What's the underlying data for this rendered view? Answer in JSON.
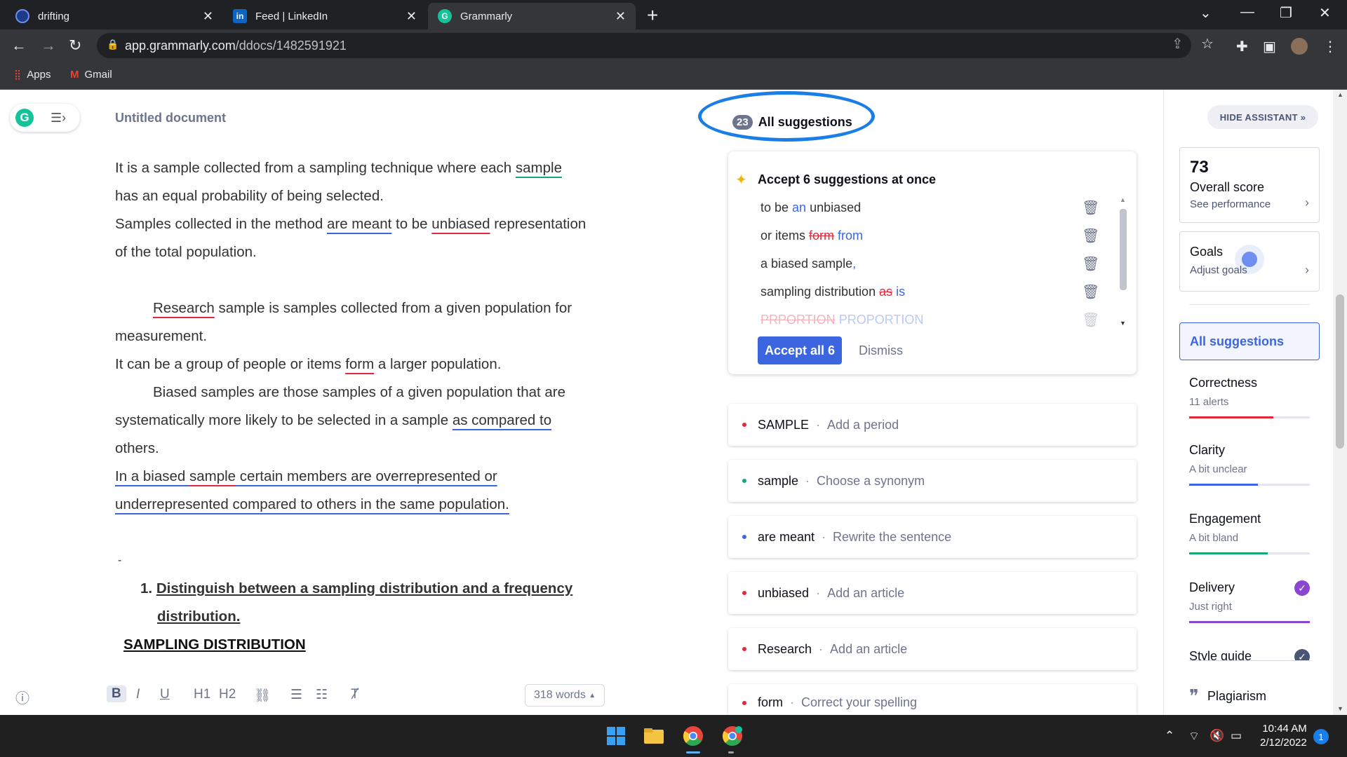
{
  "browser": {
    "tabs": [
      {
        "title": "drifting",
        "icon": "drifting-favicon"
      },
      {
        "title": "Feed | LinkedIn",
        "icon": "linkedin-favicon"
      },
      {
        "title": "Grammarly",
        "icon": "grammarly-favicon",
        "active": true
      }
    ],
    "url_host": "app.grammarly.com",
    "url_path": "/ddocs/1482591921",
    "bookmarks": [
      {
        "label": "Apps",
        "icon": "apps-grid-icon"
      },
      {
        "label": "Gmail",
        "icon": "gmail-icon"
      }
    ]
  },
  "editor": {
    "title": "Untitled document",
    "paragraphs": {
      "p1a": " It is a sample collected from a sampling technique where each ",
      "p1b": "sample",
      "p2": "has an equal probability of being selected.",
      "p3a": "Samples collected in the method ",
      "p3b": "are meant",
      "p3c": " to be ",
      "p3d": "unbiased",
      "p3e": " representation",
      "p4": "of the total population.",
      "p5a": "Research",
      "p5b": " sample is samples collected from a given population for",
      "p6": "measurement.",
      "p7a": "It can be a group of people or items ",
      "p7b": "form",
      "p7c": " a larger population.",
      "p8": "Biased samples are those samples of a given population that are",
      "p9a": "systematically more likely to be selected in a sample ",
      "p9b": "as compared to",
      "p10": "others.",
      "p11a": "In a biased ",
      "p11b": "sample",
      "p11c": " certain members are overrepresented or ",
      "p12": "underrepresented compared to others in the same population.",
      "dash": "-",
      "list_num": "1.",
      "heading_a": "Distinguish between a sampling distribution and a frequency ",
      "heading_b": "distribution.",
      "subheading": "SAMPLING DISTRIBUTION "
    },
    "toolbar": [
      "B",
      "I",
      "U",
      "H1",
      "H2"
    ],
    "word_count": "318 words"
  },
  "suggestions": {
    "count": "23",
    "header": "All suggestions",
    "accept_title": "Accept 6 suggestions at once",
    "accept_rows": [
      {
        "pre": "to be ",
        "del": "",
        "ins": "an",
        "post": " unbiased"
      },
      {
        "pre": "or items ",
        "del": "form",
        "ins": " from",
        "post": ""
      },
      {
        "pre": "a biased sample",
        "del": "",
        "ins": ",",
        "post": ""
      },
      {
        "pre": "sampling distribution ",
        "del": "as",
        "ins": " is",
        "post": ""
      },
      {
        "pre": "",
        "del": "PRPORTION",
        "ins": " PROPORTION",
        "post": ""
      }
    ],
    "accept_button": "Accept all 6",
    "dismiss_button": "Dismiss",
    "cards": [
      {
        "word": "SAMPLE",
        "action": "Add a period",
        "color": "#e0293b"
      },
      {
        "word": "sample",
        "action": "Choose a synonym",
        "color": "#15a777"
      },
      {
        "word": "are meant",
        "action": "Rewrite the sentence",
        "color": "#3c66e0"
      },
      {
        "word": "unbiased",
        "action": "Add an article",
        "color": "#e0293b"
      },
      {
        "word": "Research",
        "action": "Add an article",
        "color": "#e0293b"
      },
      {
        "word": "form",
        "action": "Correct your spelling",
        "color": "#e0293b"
      }
    ]
  },
  "assistant": {
    "hide_label": "HIDE ASSISTANT",
    "score": "73",
    "score_label": "Overall score",
    "score_link": "See performance",
    "goals_label": "Goals",
    "goals_link": "Adjust goals",
    "all_suggestions": "All suggestions",
    "categories": [
      {
        "name": "Correctness",
        "sub": "11 alerts",
        "color": "#e0293b",
        "fill": 0.7
      },
      {
        "name": "Clarity",
        "sub": "A bit unclear",
        "color": "#3c66e0",
        "fill": 0.57
      },
      {
        "name": "Engagement",
        "sub": "A bit bland",
        "color": "#15a777",
        "fill": 0.65
      },
      {
        "name": "Delivery",
        "sub": "Just right",
        "color": "#8a46d1",
        "fill": 1.0
      }
    ],
    "style_guide": "Style guide",
    "plagiarism": "Plagiarism"
  },
  "taskbar": {
    "time": "10:44 AM",
    "date": "2/12/2022",
    "notifications": "1"
  }
}
